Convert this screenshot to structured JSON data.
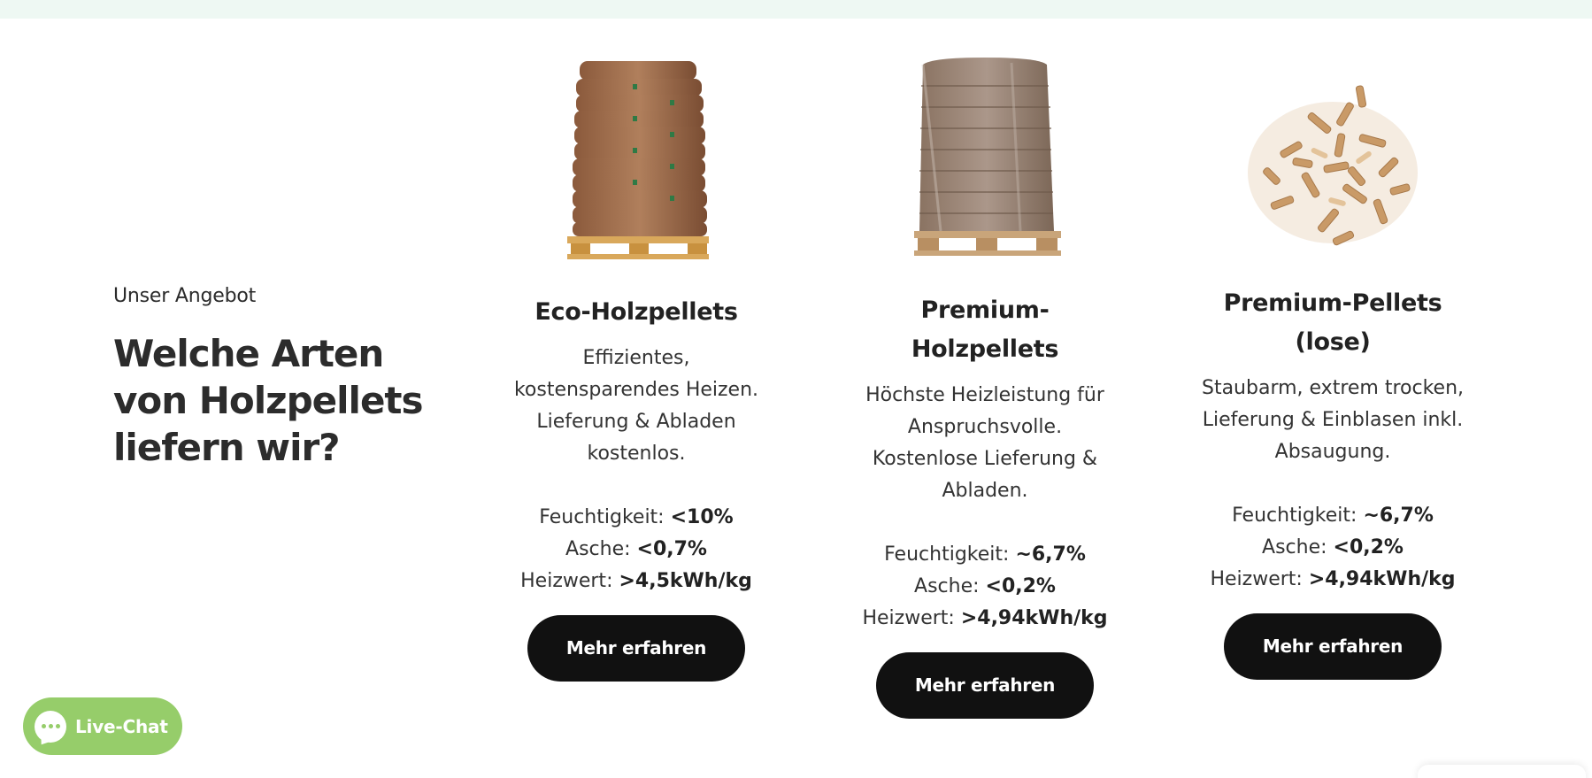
{
  "intro": {
    "eyebrow": "Unser Angebot",
    "headline": "Welche Arten von Holzpellets liefern wir?"
  },
  "products": [
    {
      "image_icon": "pallet-bags-icon",
      "title": "Eco-Holzpellets",
      "description": "Effizientes, kostensparendes Heizen. Lieferung & Abladen kostenlos.",
      "specs": [
        {
          "label": "Feuchtigkeit:",
          "value": "<10%"
        },
        {
          "label": "Asche:",
          "value": "<0,7%"
        },
        {
          "label": "Heizwert:",
          "value": ">4,5kWh/kg"
        }
      ],
      "button": "Mehr erfahren"
    },
    {
      "image_icon": "wrapped-pallet-icon",
      "title": "Premium-Holzpellets",
      "description": "Höchste Heizleistung für Anspruchsvolle. Kostenlose Lieferung & Abladen.",
      "specs": [
        {
          "label": "Feuchtigkeit:",
          "value": "~6,7%"
        },
        {
          "label": "Asche:",
          "value": "<0,2%"
        },
        {
          "label": "Heizwert:",
          "value": ">4,94kWh/kg"
        }
      ],
      "button": "Mehr erfahren"
    },
    {
      "image_icon": "loose-pellets-icon",
      "title": "Premium-Pellets (lose)",
      "description": "Staubarm, extrem trocken, Lieferung & Einblasen inkl. Absaugung.",
      "specs": [
        {
          "label": "Feuchtigkeit:",
          "value": "~6,7%"
        },
        {
          "label": "Asche:",
          "value": "<0,2%"
        },
        {
          "label": "Heizwert:",
          "value": ">4,94kWh/kg"
        }
      ],
      "button": "Mehr erfahren"
    }
  ],
  "chat": {
    "label": "Live-Chat",
    "icon": "chat-bubble-icon",
    "color": "#96cd6a"
  },
  "colors": {
    "button_bg": "#111111",
    "top_strip": "#eef8f3"
  }
}
